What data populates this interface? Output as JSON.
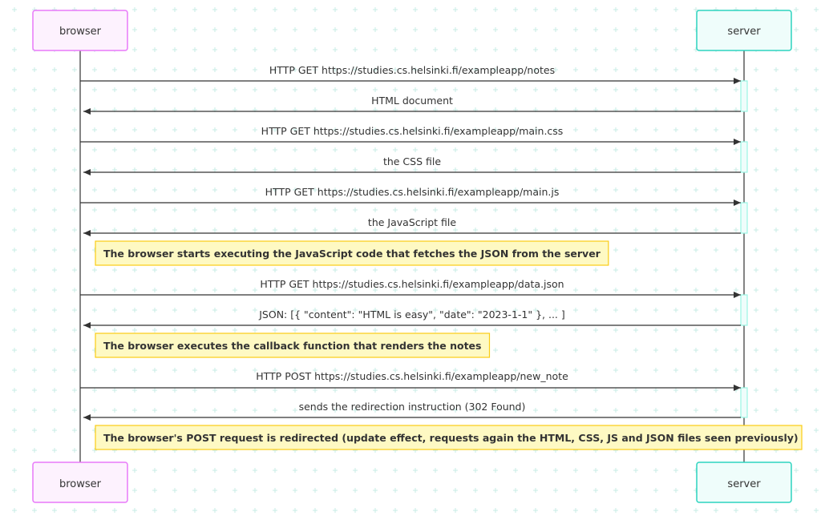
{
  "colors": {
    "browser_border": "#e879f9",
    "browser_fill": "#fdf2fe",
    "server_border": "#2dd4bf",
    "server_fill": "#effdfb",
    "activation_border": "#99f6e4",
    "activation_fill": "#effdfb",
    "note_border": "#facc15",
    "note_fill": "#fef9c3",
    "line": "#333333",
    "grid": "#c7ece6"
  },
  "actors": {
    "browser": "browser",
    "server": "server"
  },
  "steps": [
    {
      "kind": "request",
      "text": "HTTP GET https://studies.cs.helsinki.fi/exampleapp/notes"
    },
    {
      "kind": "response",
      "text": "HTML document"
    },
    {
      "kind": "request",
      "text": "HTTP GET https://studies.cs.helsinki.fi/exampleapp/main.css"
    },
    {
      "kind": "response",
      "text": "the CSS file"
    },
    {
      "kind": "request",
      "text": "HTTP GET https://studies.cs.helsinki.fi/exampleapp/main.js"
    },
    {
      "kind": "response",
      "text": "the JavaScript file"
    },
    {
      "kind": "note",
      "text": "The browser starts executing the JavaScript code that fetches the JSON from the server"
    },
    {
      "kind": "request",
      "text": "HTTP GET https://studies.cs.helsinki.fi/exampleapp/data.json"
    },
    {
      "kind": "response",
      "text": "JSON: [{ \"content\": \"HTML is easy\", \"date\": \"2023-1-1\" }, ... ]"
    },
    {
      "kind": "note",
      "text": "The browser executes the callback function that renders the notes"
    },
    {
      "kind": "request",
      "text": "HTTP POST https://studies.cs.helsinki.fi/exampleapp/new_note"
    },
    {
      "kind": "response",
      "text": "sends the redirection instruction (302 Found)"
    },
    {
      "kind": "note",
      "text": "The browser's POST request is redirected (update effect, requests again the HTML, CSS, JS and JSON files seen previously)"
    }
  ]
}
